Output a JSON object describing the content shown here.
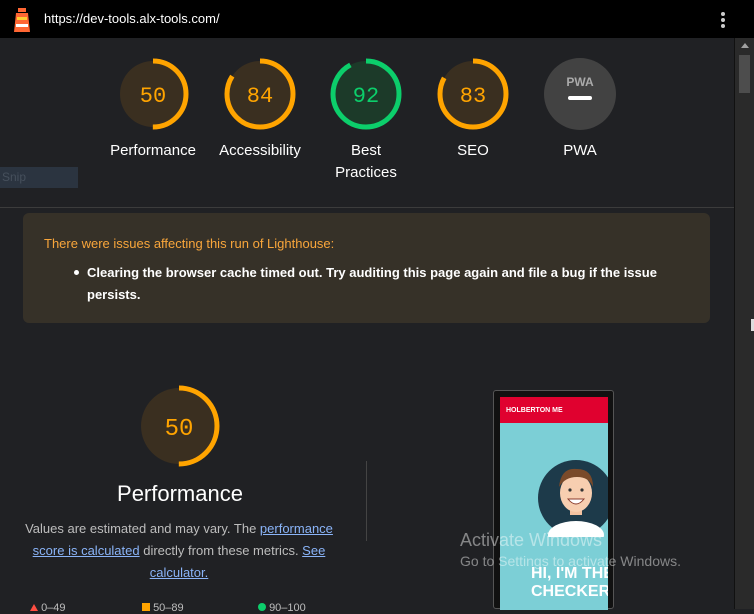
{
  "browser": {
    "url": "https://dev-tools.alx-tools.com/"
  },
  "gauges": [
    {
      "score": "50",
      "label": "Performance",
      "value": 0.5,
      "color": "#ffa400",
      "track": "#3a2f20"
    },
    {
      "score": "84",
      "label": "Accessibility",
      "value": 0.84,
      "color": "#ffa400",
      "track": "#3a2f20"
    },
    {
      "score": "92",
      "label_line1": "Best",
      "label_line2": "Practices",
      "value": 0.92,
      "color": "#0cce6b",
      "track": "#1c3a29"
    },
    {
      "score": "83",
      "label": "SEO",
      "value": 0.83,
      "color": "#ffa400",
      "track": "#3a2f20"
    },
    {
      "badge": "PWA",
      "label": "PWA"
    }
  ],
  "snip": {
    "label": "Snip"
  },
  "warning": {
    "title": "There were issues affecting this run of Lighthouse:",
    "items": [
      "Clearing the browser cache timed out. Try auditing this page again and file a bug if the issue persists."
    ]
  },
  "performance": {
    "score": "50",
    "value": 0.5,
    "title": "Performance",
    "desc_prefix": "Values are estimated and may vary. The ",
    "link1": "performance score is calculated",
    "desc_mid": " directly from these metrics. ",
    "link2": "See calculator."
  },
  "legend": [
    {
      "label": "0–49",
      "color": "#ff4e42"
    },
    {
      "label": "50–89",
      "color": "#ffa400"
    },
    {
      "label": "90–100",
      "color": "#0cce6b"
    }
  ],
  "screenshot": {
    "header": "HOLBERTON ME",
    "hero": "HI, I'M THE CHECKER"
  },
  "watermark": {
    "line1": "Activate Windows",
    "line2": "Go to Settings to activate Windows."
  },
  "colors": {
    "accent_orange": "#ffa400",
    "accent_green": "#0cce6b",
    "warning_title": "#f9a63b",
    "link": "#8ab4f8"
  }
}
